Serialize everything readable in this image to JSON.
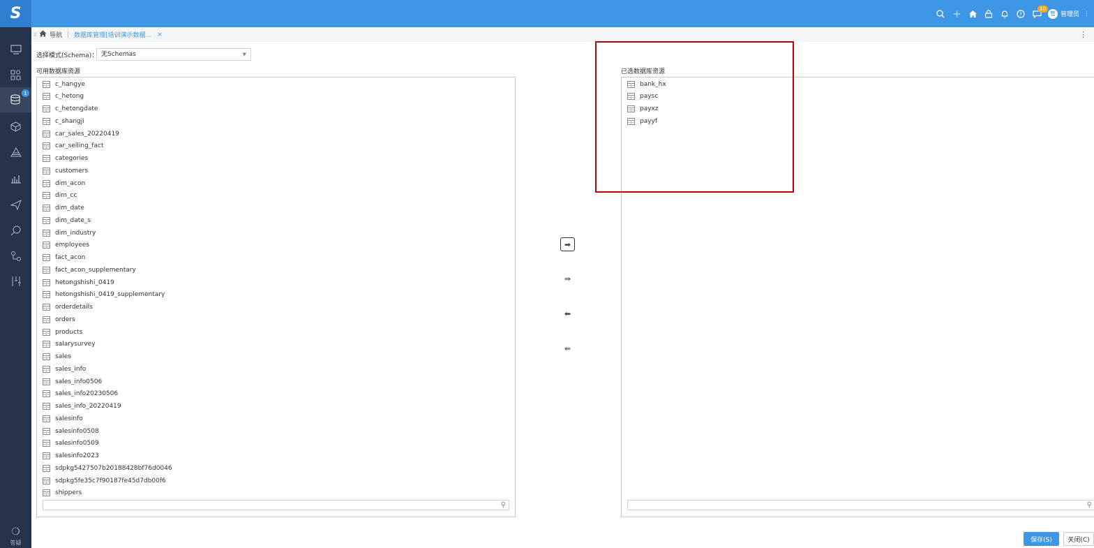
{
  "app": {
    "logo_text": "S",
    "accent_color": "#3d96e6",
    "header_icons": [
      "search-icon",
      "plus-icon",
      "home-icon",
      "lock-icon",
      "bell-icon",
      "help-icon",
      "chat-icon"
    ],
    "chat_badge": "10",
    "avatar_text": "管",
    "user_name": "管理员",
    "user_menu_icon": "⋮"
  },
  "sidebar": {
    "items": [
      "monitor-icon",
      "apps-icon",
      "database-icon",
      "cube-icon",
      "layers-icon",
      "chart-icon",
      "send-icon",
      "analysis-icon",
      "flow-icon",
      "tools-icon"
    ],
    "badge": "1",
    "bottom_label": "答疑"
  },
  "breadcrumb": {
    "nav_label": "导航",
    "tab_label": "数据库管理[培训演示数据...",
    "close": "×",
    "more": "⋮"
  },
  "schema": {
    "label": "选择模式(Schema)：",
    "selected": "无Schemas"
  },
  "available": {
    "title": "可用数据库资源",
    "items": [
      "c_hangye",
      "c_hetong",
      "c_hetongdate",
      "c_shangji",
      "car_sales_20220419",
      "car_selling_fact",
      "categories",
      "customers",
      "dim_acon",
      "dim_cc",
      "dim_date",
      "dim_date_s",
      "dim_industry",
      "employees",
      "fact_acon",
      "fact_acon_supplementary",
      "hetongshishi_0419",
      "hetongshishi_0419_supplementary",
      "orderdetails",
      "orders",
      "products",
      "salarysurvey",
      "sales",
      "sales_info",
      "sales_info0506",
      "sales_info20230506",
      "sales_info_20220419",
      "salesinfo",
      "salesinfo0508",
      "salesinfo0509",
      "salesinfo2023",
      "sdpkg5427507b20188428bf76d0046",
      "sdpkg5fe35c7f90187fe45d7db00f6",
      "shippers"
    ],
    "search_placeholder": ""
  },
  "selected": {
    "title": "已选数据库资源",
    "items": [
      "bank_hx",
      "paysc",
      "payxz",
      "payyf"
    ],
    "search_placeholder": ""
  },
  "transfer": {
    "add_one": "➡",
    "add_all": "⇛",
    "remove_one": "⬅",
    "remove_all": "⇚"
  },
  "footer": {
    "save_label": "保存(S)",
    "close_label": "关闭(C)"
  }
}
